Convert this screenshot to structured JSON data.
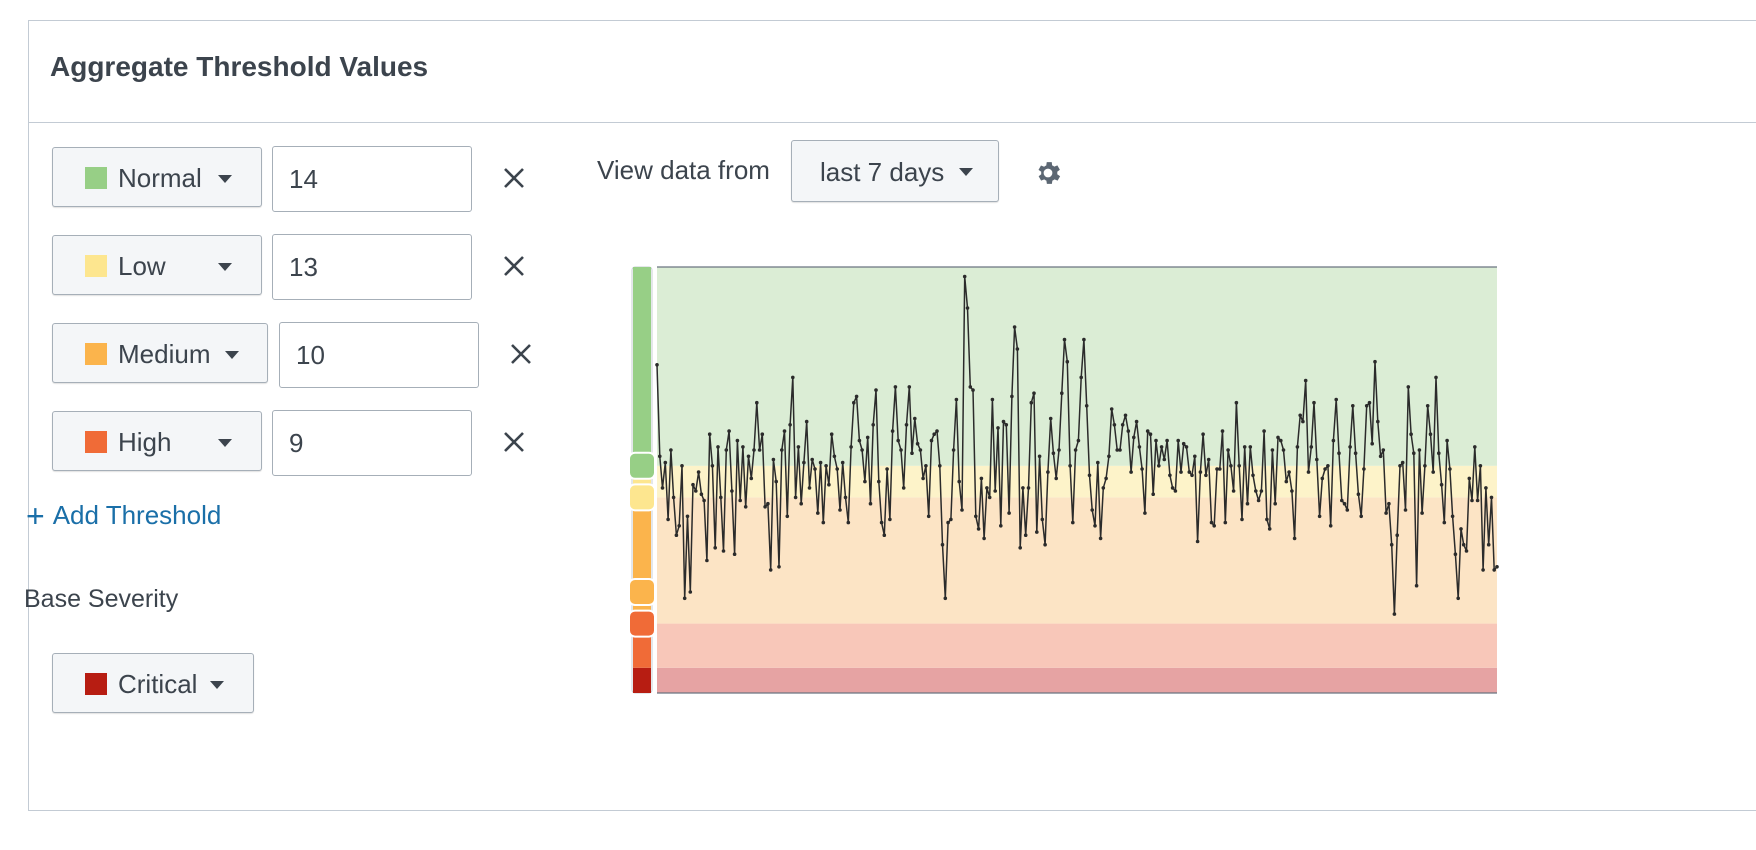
{
  "panel": {
    "title": "Aggregate Threshold Values"
  },
  "thresholds": [
    {
      "label": "Normal",
      "value": "14",
      "color": "#97cf86"
    },
    {
      "label": "Low",
      "value": "13",
      "color": "#fde68f"
    },
    {
      "label": "Medium",
      "value": "10",
      "color": "#fbb44c"
    },
    {
      "label": "High",
      "value": "9",
      "color": "#f06b37"
    }
  ],
  "add_threshold_label": "Add Threshold",
  "base_severity": {
    "label": "Base Severity",
    "value": "Critical",
    "color": "#b71d12"
  },
  "view": {
    "label": "View data from",
    "range": "last 7 days"
  },
  "icons": {
    "remove": "close-icon",
    "settings": "gear-icon",
    "add": "plus-icon",
    "dropdown": "caret-down-icon"
  },
  "chart_data": {
    "type": "line",
    "title": "",
    "xlabel": "",
    "ylabel": "",
    "ylim": [
      6.8,
      20.3
    ],
    "bands": [
      {
        "severity": "Critical",
        "from": 6.8,
        "to": 7.6,
        "color": "#e6a3a3"
      },
      {
        "severity": "High",
        "from": 7.6,
        "to": 9,
        "color": "#f8c7b9"
      },
      {
        "severity": "Medium",
        "from": 9,
        "to": 13,
        "color": "#fce4c5"
      },
      {
        "severity": "Low",
        "from": 13,
        "to": 14,
        "color": "#fdf3c9"
      },
      {
        "severity": "Normal",
        "from": 14,
        "to": 20.3,
        "color": "#dbedd5"
      }
    ],
    "series": [
      {
        "values": [
          17.2,
          14.3,
          13.3,
          14.1,
          12.3,
          14.5,
          13.0,
          11.8,
          12.1,
          14.0,
          9.8,
          12.4,
          10.0,
          13.4,
          13.2,
          13.8,
          13.1,
          12.9,
          11.0,
          15.0,
          14.0,
          11.4,
          14.6,
          13.0,
          11.3,
          14.5,
          15.1,
          13.2,
          11.2,
          14.8,
          12.9,
          14.6,
          12.7,
          14.3,
          13.6,
          14.5,
          16.0,
          14.5,
          15.0,
          12.7,
          12.8,
          10.7,
          14.2,
          13.5,
          10.8,
          14.5,
          15.1,
          12.4,
          15.3,
          16.8,
          13.0,
          14.6,
          12.8,
          14.1,
          15.4,
          13.3,
          14.2,
          13.9,
          12.5,
          14.1,
          12.2,
          14.0,
          13.4,
          15.0,
          14.3,
          13.9,
          12.6,
          14.1,
          13.0,
          12.2,
          14.6,
          16.0,
          16.2,
          14.8,
          14.5,
          13.5,
          14.9,
          12.8,
          15.3,
          16.4,
          13.5,
          12.2,
          11.8,
          13.9,
          12.3,
          15.1,
          16.5,
          14.8,
          14.5,
          13.3,
          15.3,
          16.5,
          14.4,
          15.5,
          14.7,
          14.5,
          13.6,
          14.0,
          12.4,
          14.8,
          15.0,
          15.1,
          14.0,
          11.5,
          9.8,
          12.2,
          12.3,
          14.5,
          16.1,
          13.5,
          12.6,
          20.0,
          19.0,
          16.5,
          16.4,
          12.4,
          12.0,
          13.6,
          11.7,
          13.3,
          13.0,
          16.1,
          13.2,
          15.2,
          12.1,
          15.4,
          15.3,
          12.5,
          16.2,
          18.4,
          17.7,
          11.4,
          13.3,
          11.8,
          13.3,
          16.0,
          16.3,
          11.9,
          14.3,
          12.3,
          11.5,
          13.8,
          15.5,
          14.4,
          13.6,
          14.5,
          16.3,
          18.0,
          17.3,
          14.0,
          12.2,
          14.5,
          14.8,
          16.8,
          18.0,
          15.9,
          13.7,
          12.6,
          12.1,
          14.1,
          11.7,
          13.3,
          13.6,
          14.3,
          15.8,
          15.3,
          14.5,
          14.5,
          15.3,
          15.6,
          15.1,
          13.8,
          14.9,
          15.4,
          14.6,
          13.9,
          12.5,
          15.1,
          15.0,
          13.1,
          14.8,
          14.0,
          14.6,
          14.2,
          14.8,
          13.7,
          13.3,
          13.2,
          14.8,
          13.8,
          14.7,
          14.6,
          13.8,
          13.7,
          14.3,
          11.6,
          13.8,
          15.0,
          13.7,
          14.2,
          12.2,
          12.1,
          13.9,
          13.9,
          15.1,
          12.2,
          14.5,
          14.0,
          13.2,
          16.0,
          14.0,
          12.3,
          14.6,
          12.8,
          14.6,
          13.7,
          13.2,
          12.9,
          13.2,
          15.1,
          12.3,
          12.0,
          14.5,
          12.8,
          14.9,
          14.8,
          14.5,
          13.5,
          13.8,
          13.2,
          11.7,
          14.6,
          15.6,
          15.4,
          16.7,
          13.8,
          14.6,
          16.0,
          14.2,
          12.4,
          13.6,
          13.9,
          14.0,
          12.1,
          14.8,
          16.1,
          14.4,
          12.9,
          12.8,
          12.6,
          14.6,
          15.9,
          14.4,
          13.1,
          12.4,
          13.9,
          15.9,
          16.0,
          14.7,
          17.3,
          15.4,
          14.3,
          14.5,
          12.5,
          12.8,
          11.5,
          9.3,
          11.8,
          14.0,
          14.1,
          12.6,
          16.5,
          15.0,
          14.4,
          10.2,
          14.5,
          12.5,
          14.0,
          15.9,
          15.0,
          13.8,
          16.8,
          14.4,
          13.4,
          12.2,
          14.8,
          13.9,
          12.4,
          11.2,
          9.8,
          12.0,
          11.5,
          11.3,
          13.6,
          12.9,
          14.6,
          12.9,
          14.0,
          10.7,
          13.3,
          11.5,
          13.0,
          10.7,
          10.8
        ]
      }
    ]
  }
}
